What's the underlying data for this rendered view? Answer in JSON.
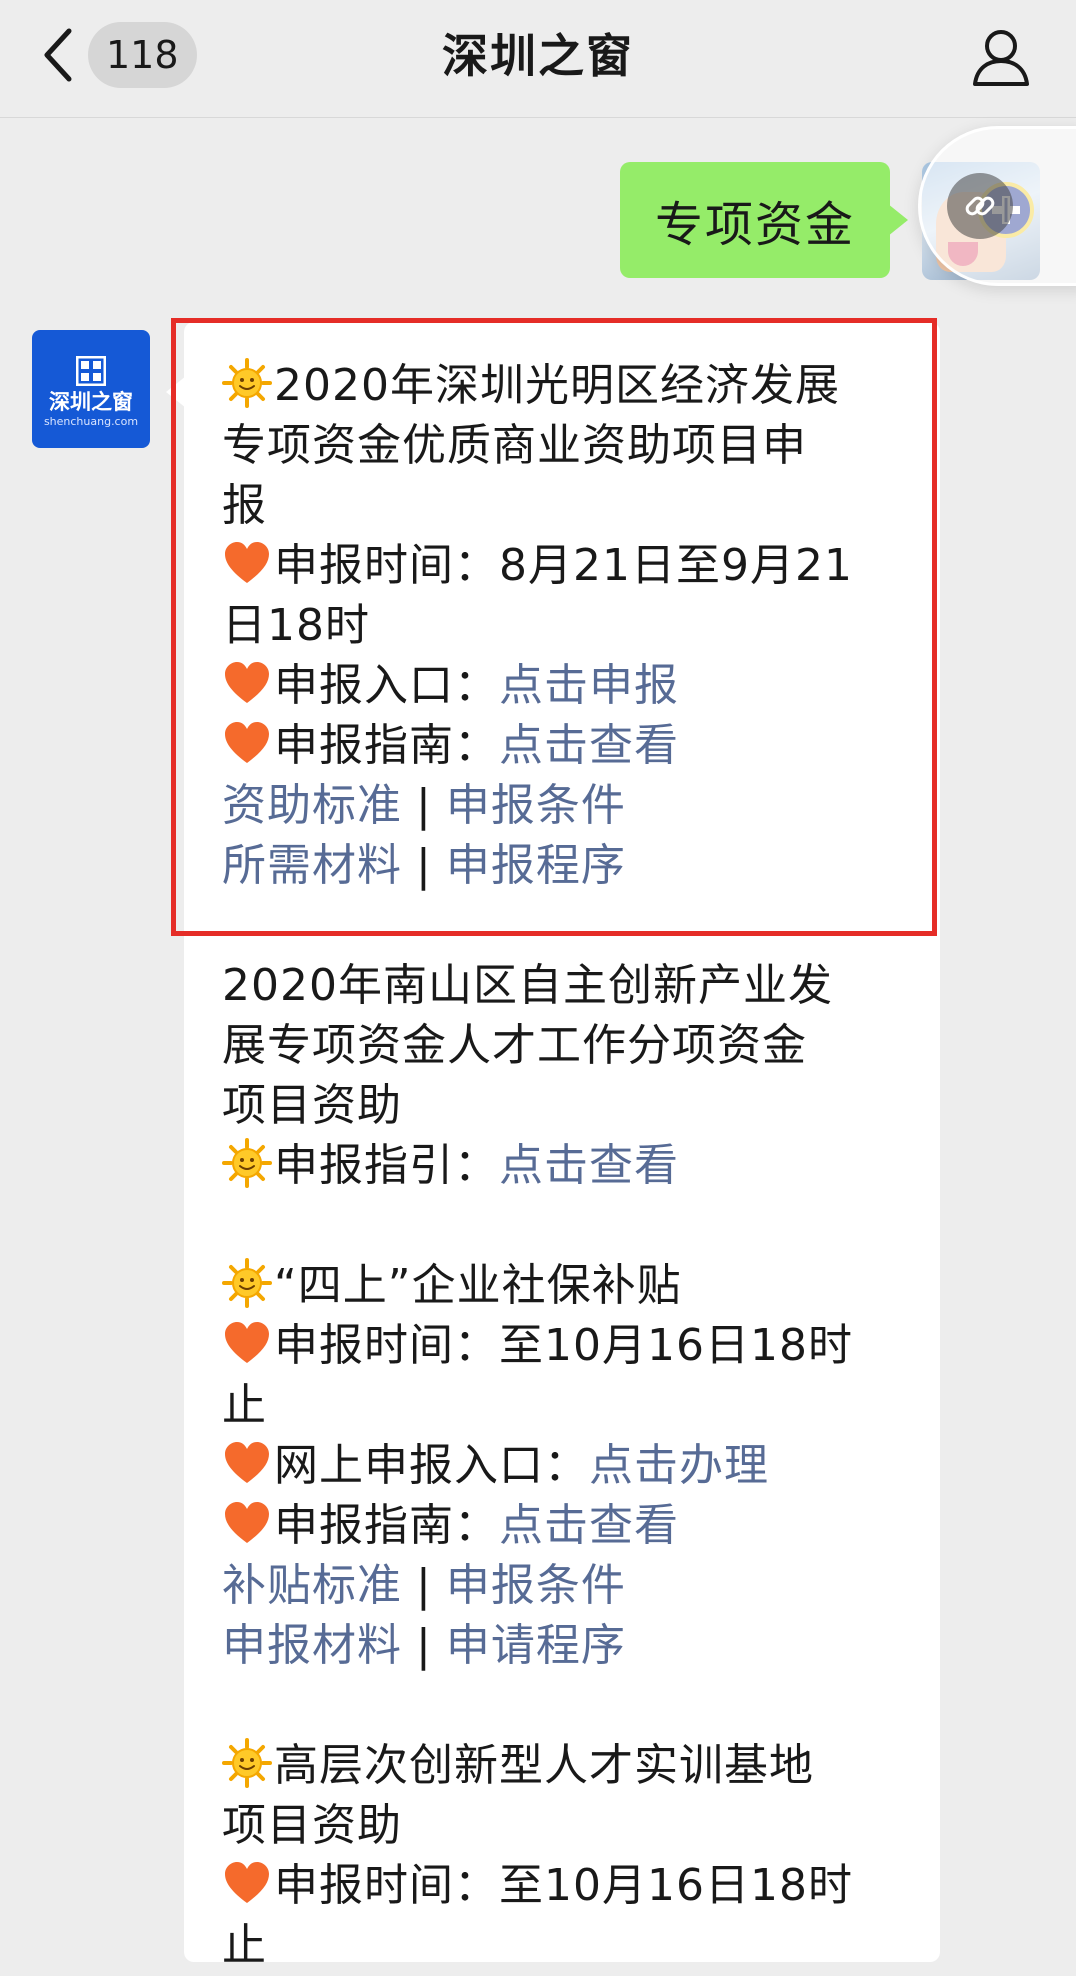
{
  "header": {
    "back_label": "返回",
    "unread_count": "118",
    "title": "深圳之窗"
  },
  "outgoing": {
    "text": "专项资金"
  },
  "official_account": {
    "name": "深圳之窗",
    "domain": "shenchuang.com"
  },
  "colors": {
    "link": "#576b95",
    "outgoing_bubble": "#95ec69",
    "highlight": "#e52d27",
    "oa_blue": "#1559d6"
  },
  "icons": {
    "sun": "sun-emoji",
    "heart": "orange-heart-emoji"
  },
  "message": {
    "s1": {
      "title_1": "2020年深圳光明区经济发展",
      "title_2": "专项资金优质商业资助项目申",
      "title_3": "报",
      "time_label": "申报时间：",
      "time_value_1": "8月21日至9月21",
      "time_value_2": "日18时",
      "entry_label": "申报入口：",
      "entry_link": "点击申报",
      "guide_label": "申报指南：",
      "guide_link": "点击查看",
      "link_a": "资助标准",
      "link_b": "申报条件",
      "link_c": "所需材料",
      "link_d": "申报程序",
      "separator": "|"
    },
    "s2": {
      "title_1": "2020年南山区自主创新产业发",
      "title_2": "展专项资金人才工作分项资金",
      "title_3": "项目资助",
      "guide_label": "申报指引：",
      "guide_link": "点击查看"
    },
    "s3": {
      "title": "“四上”企业社保补贴",
      "time_label": "申报时间：",
      "time_value_1": "至10月16日18时",
      "time_value_2": "止",
      "entry_label": "网上申报入口：",
      "entry_link": "点击办理",
      "guide_label": "申报指南：",
      "guide_link": "点击查看",
      "link_a": "补贴标准",
      "link_b": "申报条件",
      "link_c": "申报材料",
      "link_d": "申请程序",
      "separator": "|"
    },
    "s4": {
      "title_1": "高层次创新型人才实训基地",
      "title_2": "项目资助",
      "time_label": "申报时间：",
      "time_value_1": "至10月16日18时",
      "time_value_2": "止"
    }
  }
}
